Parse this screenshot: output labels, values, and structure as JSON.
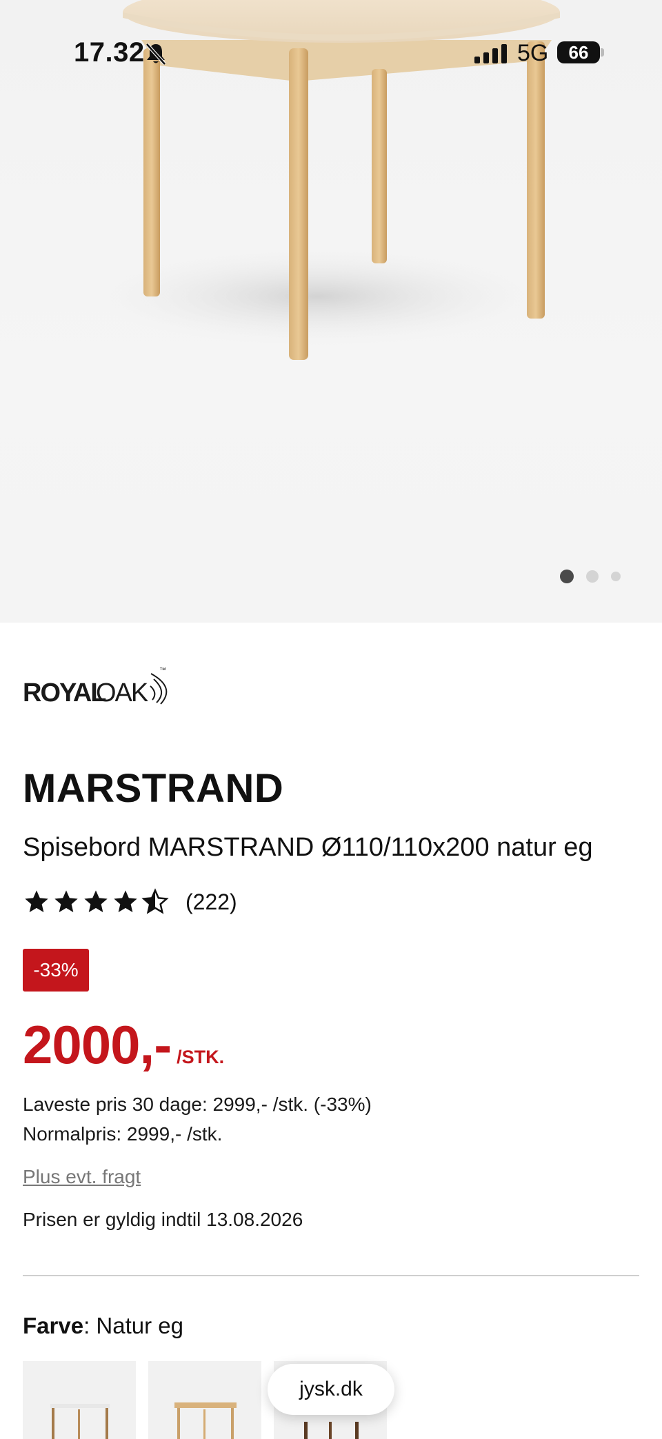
{
  "status_bar": {
    "time": "17.32",
    "network": "5G",
    "battery": "66"
  },
  "gallery": {
    "total_images": 3,
    "active_index": 0
  },
  "product": {
    "brand": "ROYALOAK",
    "brand_tm": "™",
    "name": "MARSTRAND",
    "description": "Spisebord MARSTRAND Ø110/110x200 natur eg",
    "rating": 4.5,
    "rating_max": 5,
    "review_count": "(222)",
    "discount_badge": "-33%",
    "price": "2000,-",
    "price_unit": "/STK.",
    "lowest_price_30_days": "Laveste pris 30 dage: 2999,- /stk. (-33%)",
    "normal_price": "Normalpris: 2999,- /stk.",
    "freight_link": "Plus evt. fragt",
    "price_valid": "Prisen er gyldig indtil 13.08.2026"
  },
  "color": {
    "label": "Farve",
    "separator": ": ",
    "value": "Natur eg"
  },
  "browser": {
    "url": "jysk.dk"
  },
  "colors": {
    "sale_red": "#c4161c",
    "text": "#111111",
    "muted_link": "#777777"
  }
}
